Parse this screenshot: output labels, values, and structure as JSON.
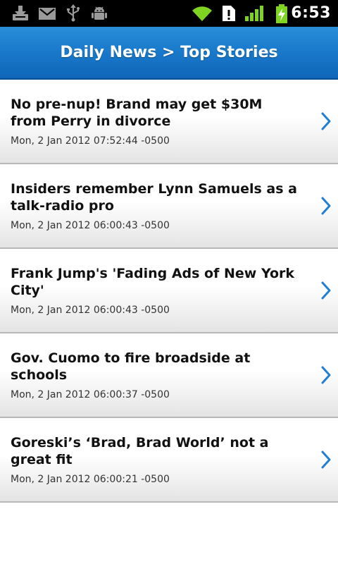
{
  "status_bar": {
    "time": "6:53",
    "icons": [
      "download-icon",
      "gmail-icon",
      "usb-icon",
      "android-debug-icon",
      "wifi-icon",
      "alert-icon",
      "signal-icon",
      "battery-charging-icon"
    ]
  },
  "header": {
    "title": "Daily News > Top Stories"
  },
  "colors": {
    "header_blue": "#1a7acc",
    "chevron_blue": "#1e7fd6",
    "status_green": "#7fd321"
  },
  "stories": [
    {
      "title": "No pre-nup! Brand may get $30M from Perry in divorce",
      "date": "Mon, 2 Jan 2012 07:52:44 -0500"
    },
    {
      "title": "Insiders remember Lynn Samuels as a talk-radio pro",
      "date": "Mon, 2 Jan 2012 06:00:43 -0500"
    },
    {
      "title": "Frank Jump's 'Fading Ads of New York City'",
      "date": "Mon, 2 Jan 2012 06:00:43 -0500"
    },
    {
      "title": "Gov. Cuomo to fire broadside at schools",
      "date": "Mon, 2 Jan 2012 06:00:37 -0500"
    },
    {
      "title": "Goreski’s ‘Brad, Brad World’ not a  great fit",
      "date": "Mon, 2 Jan 2012 06:00:21 -0500"
    }
  ]
}
